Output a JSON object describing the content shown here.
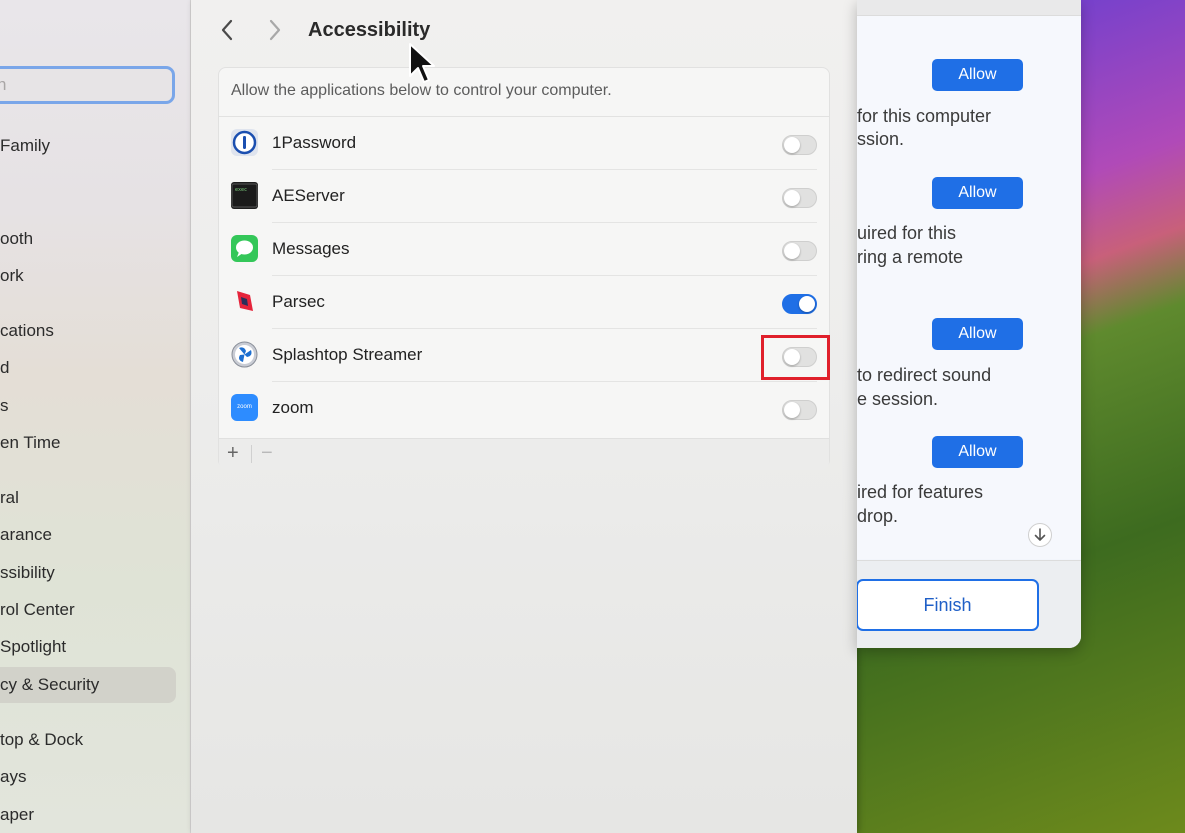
{
  "sidebar": {
    "search_placeholder": "h",
    "items": [
      {
        "label": "Family"
      },
      {
        "label": "ooth"
      },
      {
        "label": "ork"
      },
      {
        "label": "cations"
      },
      {
        "label": "d"
      },
      {
        "label": "s"
      },
      {
        "label": "en Time"
      },
      {
        "label": "ral"
      },
      {
        "label": "arance"
      },
      {
        "label": "ssibility"
      },
      {
        "label": "rol Center"
      },
      {
        "label": " Spotlight"
      },
      {
        "label": "cy & Security"
      },
      {
        "label": "top & Dock"
      },
      {
        "label": "ays"
      },
      {
        "label": "aper"
      }
    ]
  },
  "main": {
    "back_icon": "chevron-left-icon",
    "forward_icon": "chevron-right-icon",
    "title": "Accessibility",
    "description": "Allow the applications below to control your computer.",
    "apps": [
      {
        "name": "1Password",
        "enabled": false
      },
      {
        "name": "AEServer",
        "enabled": false
      },
      {
        "name": "Messages",
        "enabled": false
      },
      {
        "name": "Parsec",
        "enabled": true
      },
      {
        "name": "Splashtop Streamer",
        "enabled": false
      },
      {
        "name": "zoom",
        "enabled": false
      }
    ],
    "add_label": "+",
    "remove_label": "−"
  },
  "dialog": {
    "allow_label": "Allow",
    "text_1a": "for this computer",
    "text_1b": "ssion.",
    "text_2a": "uired for this",
    "text_2b": "ring a remote",
    "text_3a": "to redirect sound",
    "text_3b": "e session.",
    "text_4a": "ired for features",
    "text_4b": "drop.",
    "scroll_icon": "arrow-down-icon",
    "finish_label": "Finish"
  },
  "colors": {
    "accent": "#1f6fe6",
    "highlight_box": "#e0202b"
  },
  "zoom_icon_text": "zoom"
}
